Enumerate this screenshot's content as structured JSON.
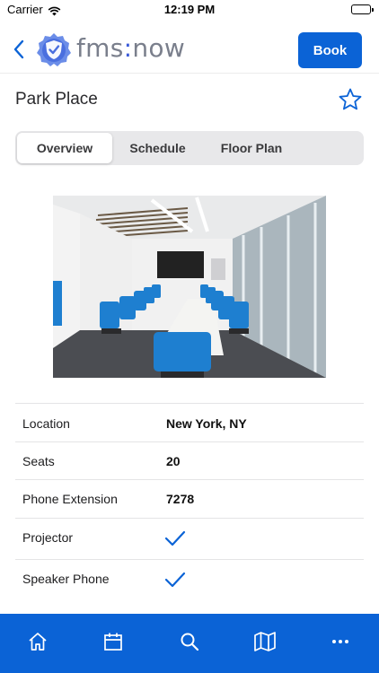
{
  "status_bar": {
    "carrier": "Carrier",
    "time": "12:19 PM"
  },
  "header": {
    "logo_prefix": "fms",
    "logo_colon": ":",
    "logo_suffix": "now",
    "book_label": "Book",
    "accent_color": "#0b63d6"
  },
  "room": {
    "title": "Park Place",
    "favorite": false
  },
  "tabs": [
    {
      "label": "Overview",
      "active": true
    },
    {
      "label": "Schedule",
      "active": false
    },
    {
      "label": "Floor Plan",
      "active": false
    }
  ],
  "details": [
    {
      "label": "Location",
      "value": "New York, NY"
    },
    {
      "label": "Seats",
      "value": "20"
    },
    {
      "label": "Phone Extension",
      "value": "7278"
    },
    {
      "label": "Projector",
      "value": true,
      "icon": "checkmark-icon"
    },
    {
      "label": "Speaker Phone",
      "value": true,
      "icon": "checkmark-icon"
    }
  ],
  "bottom_nav": {
    "icons": [
      "home-icon",
      "calendar-icon",
      "search-icon",
      "map-icon",
      "more-icon"
    ],
    "background": "#0b63d6"
  }
}
